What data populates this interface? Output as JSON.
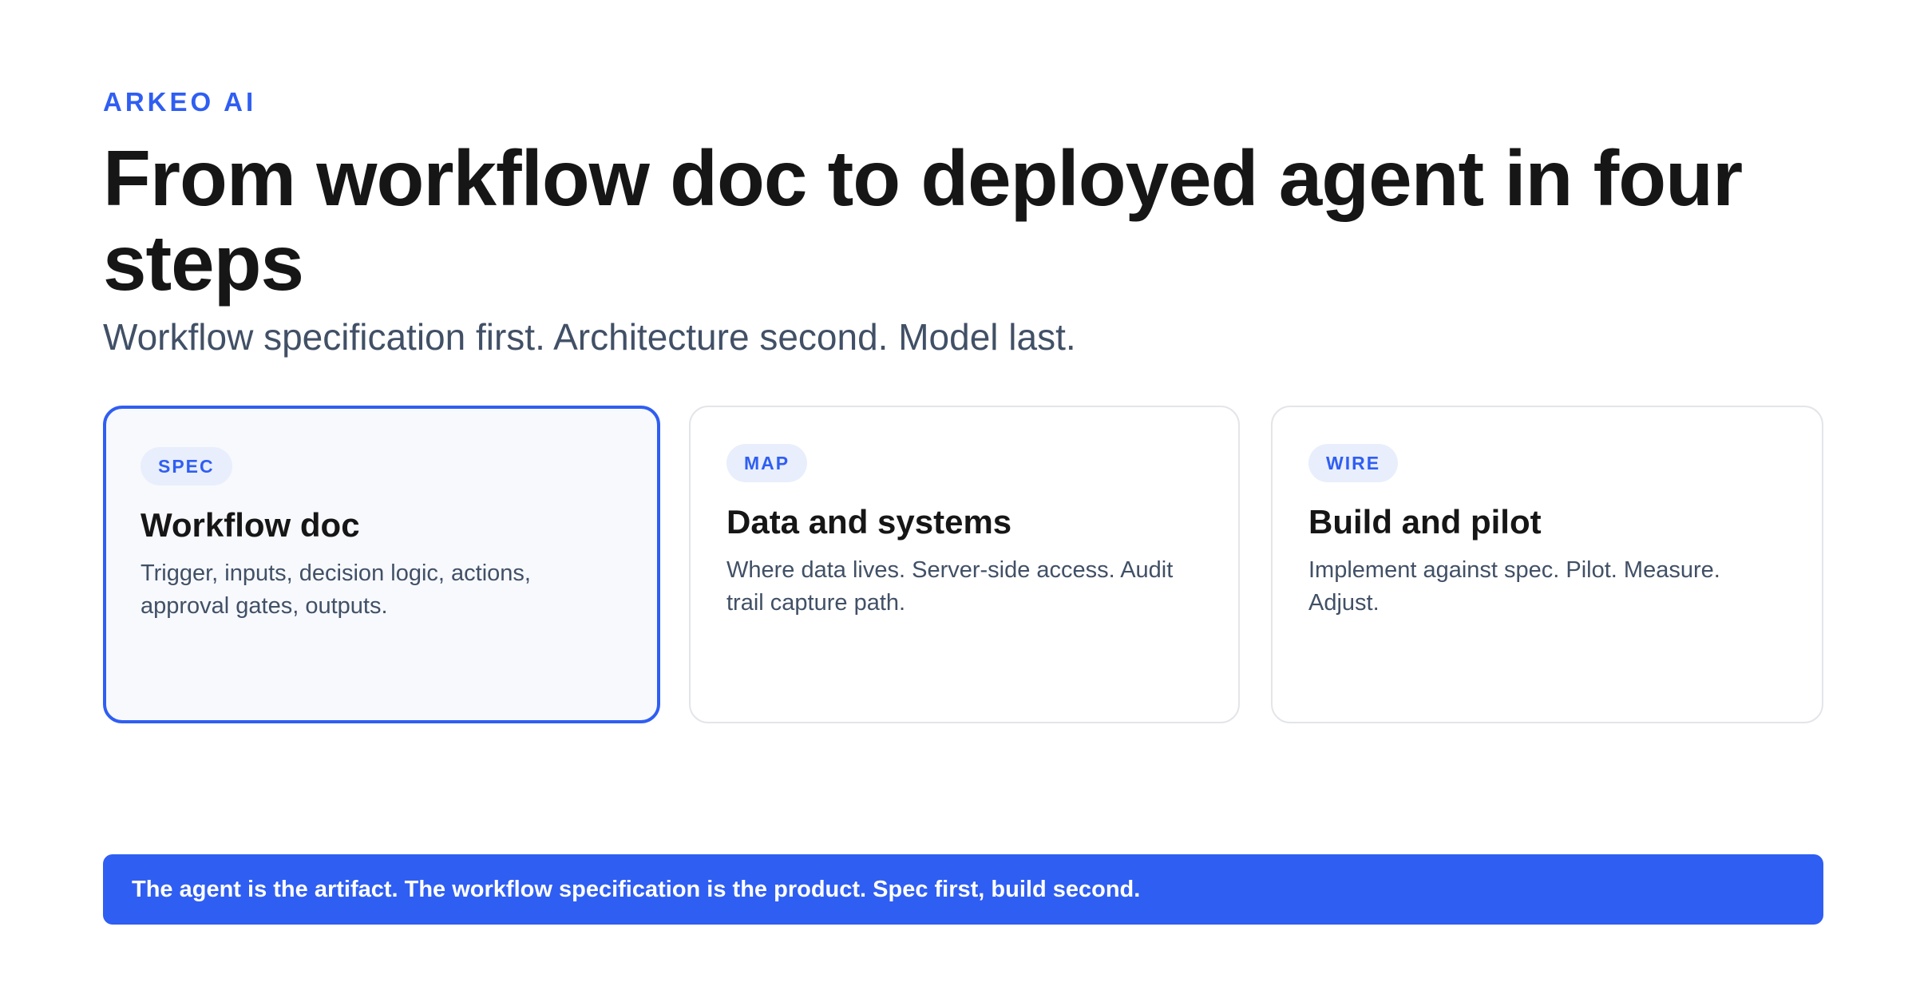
{
  "header": {
    "eyebrow": "ARKEO AI",
    "title": "From workflow doc to deployed agent in four steps",
    "subtitle": "Workflow specification first. Architecture second. Model last."
  },
  "cards": [
    {
      "badge": "SPEC",
      "title": "Workflow doc",
      "description": "Trigger, inputs, decision logic, actions, approval gates, outputs.",
      "active": true
    },
    {
      "badge": "MAP",
      "title": "Data and systems",
      "description": "Where data lives. Server-side access. Audit trail capture path.",
      "active": false
    },
    {
      "badge": "WIRE",
      "title": "Build and pilot",
      "description": "Implement against spec. Pilot. Measure. Adjust.",
      "active": false
    }
  ],
  "banner": {
    "text": "The agent is the artifact. The workflow specification is the product. Spec first, build second."
  },
  "colors": {
    "accent": "#2f5ef2",
    "heading": "#161616",
    "body_text": "#415066",
    "badge_bg": "#e8eefc",
    "card_border": "#e3e5e9",
    "active_card_bg": "#f7f9fd"
  }
}
